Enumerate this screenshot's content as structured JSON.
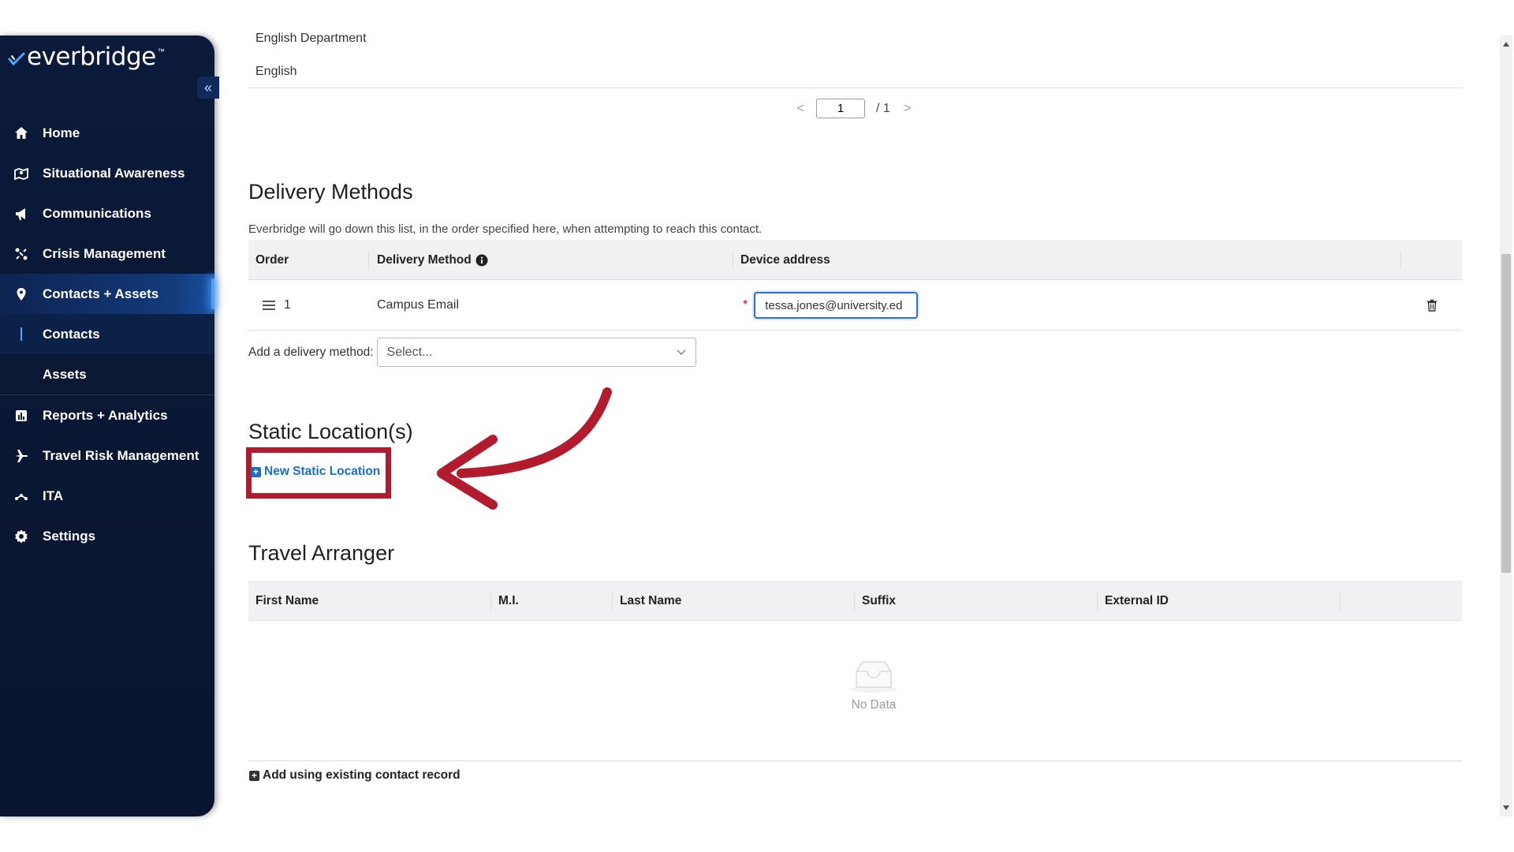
{
  "sidebar": {
    "logo_text": "everbridge",
    "logo_tm": "™",
    "collapse_icon": "«",
    "items": [
      {
        "label": "Home",
        "icon": "home-icon"
      },
      {
        "label": "Situational Awareness",
        "icon": "map-icon"
      },
      {
        "label": "Communications",
        "icon": "megaphone-icon"
      },
      {
        "label": "Crisis Management",
        "icon": "crisis-icon"
      },
      {
        "label": "Contacts + Assets",
        "icon": "location-pin-icon"
      },
      {
        "label": "Contacts"
      },
      {
        "label": "Assets"
      },
      {
        "label": "Reports + Analytics",
        "icon": "bar-chart-icon"
      },
      {
        "label": "Travel Risk Management",
        "icon": "airplane-icon"
      },
      {
        "label": "ITA",
        "icon": "ita-icon"
      },
      {
        "label": "Settings",
        "icon": "gear-icon"
      }
    ],
    "active_item": "Contacts + Assets",
    "current_subitem": "Contacts"
  },
  "top_rows": {
    "row1": "English Department",
    "row2": "English"
  },
  "pagination": {
    "prev": "<",
    "current_page": "1",
    "total": "/ 1",
    "next": ">"
  },
  "delivery_methods": {
    "title": "Delivery Methods",
    "description": "Everbridge will go down this list, in the order specified here, when attempting to reach this contact.",
    "columns": [
      "Order",
      "Delivery Method",
      "Device address"
    ],
    "rows": [
      {
        "order": "1",
        "method": "Campus Email",
        "required_mark": "*",
        "address": "tessa.jones@university.ed"
      }
    ],
    "add_label": "Add a delivery method:",
    "select_placeholder": "Select..."
  },
  "static_locations": {
    "title": "Static Location(s)",
    "new_button": "New Static Location",
    "plus_glyph": "+"
  },
  "travel_arranger": {
    "title": "Travel Arranger",
    "columns": [
      "First Name",
      "M.I.",
      "Last Name",
      "Suffix",
      "External ID"
    ],
    "empty_text": "No Data",
    "add_existing": "Add using existing contact record"
  },
  "colors": {
    "sidebar_bg": "#0a1733",
    "accent_blue": "#1a6ec7",
    "annotation_red": "#b21a2e",
    "required_red": "#d0021b"
  }
}
